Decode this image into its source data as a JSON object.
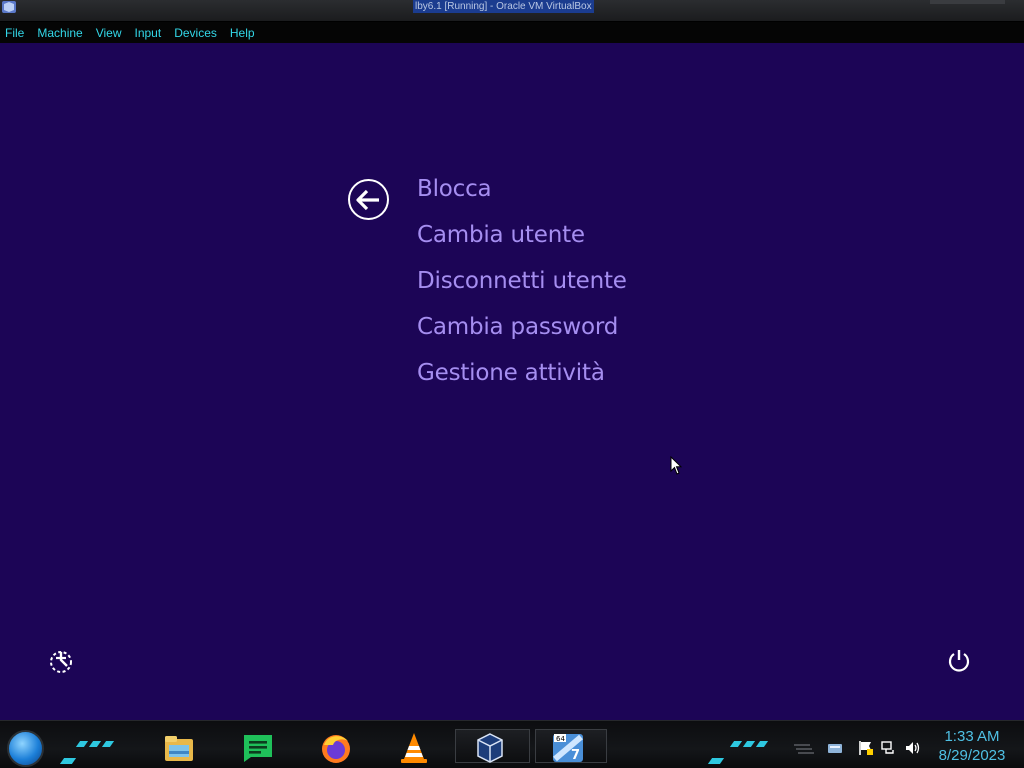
{
  "window": {
    "title": "lby6.1 [Running] - Oracle VM VirtualBox"
  },
  "menubar": {
    "items": [
      {
        "label": "File"
      },
      {
        "label": "Machine"
      },
      {
        "label": "View"
      },
      {
        "label": "Input"
      },
      {
        "label": "Devices"
      },
      {
        "label": "Help"
      }
    ]
  },
  "security_screen": {
    "options": [
      {
        "label": "Blocca"
      },
      {
        "label": "Cambia utente"
      },
      {
        "label": "Disconnetti utente"
      },
      {
        "label": "Cambia password"
      },
      {
        "label": "Gestione attività"
      }
    ]
  },
  "taskbar": {
    "apps": [
      {
        "icon": "file-explorer-icon"
      },
      {
        "icon": "chat-app-icon"
      },
      {
        "icon": "firefox-icon"
      },
      {
        "icon": "vlc-icon"
      },
      {
        "icon": "virtualbox-icon"
      },
      {
        "icon": "windows-7-x64-icon"
      }
    ],
    "tray_icons": [
      "network-drive-icon",
      "action-center-flag-icon",
      "network-icon",
      "volume-icon"
    ],
    "clock": {
      "time": "1:33 AM",
      "date": "8/29/2023"
    }
  },
  "colors": {
    "screen_background": "#1c0556",
    "option_text": "#a58ef0",
    "menu_text": "#33d7e8",
    "clock_text": "#4fc0e4"
  }
}
